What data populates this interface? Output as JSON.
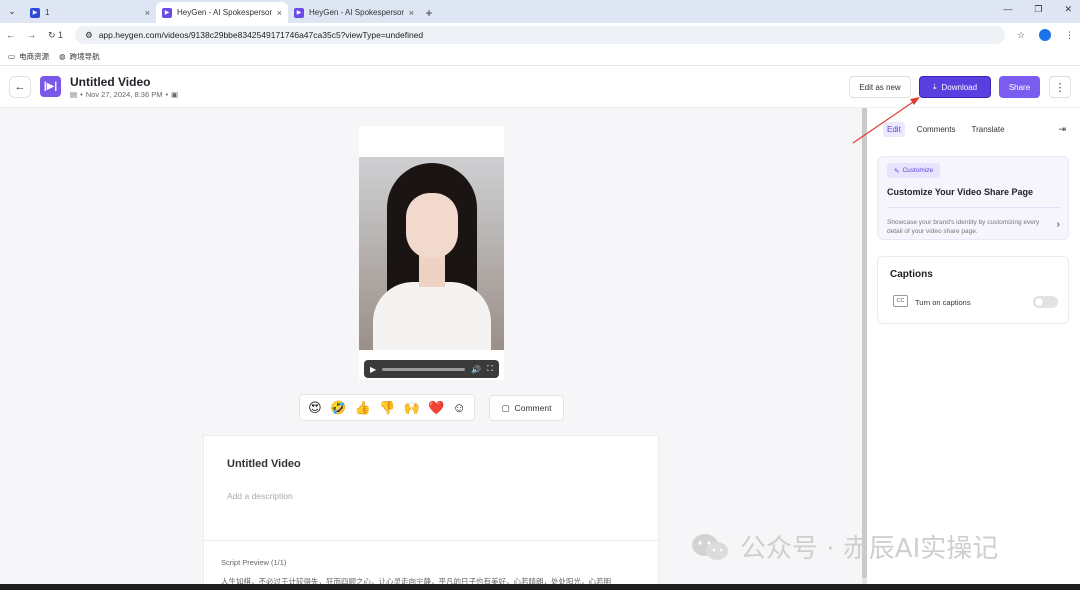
{
  "browser": {
    "tabs": [
      {
        "title": "1",
        "active": false
      },
      {
        "title": "HeyGen - AI Spokesperson V",
        "active": true
      },
      {
        "title": "HeyGen - AI Spokesperson V",
        "active": false
      }
    ],
    "tab_close_glyph": "×",
    "new_tab_glyph": "+",
    "url": "app.heygen.com/videos/9138c29bbe8342549171746a47ca35c5?viewType=undefined",
    "reload_badge": "1",
    "bookmarks": [
      "电商资源",
      "跨境导航"
    ]
  },
  "header": {
    "video_title": "Untitled Video",
    "meta_date": "Nov 27, 2024, 8:36 PM",
    "edit_as_new": "Edit as new",
    "download": "Download",
    "share": "Share"
  },
  "player": {
    "reactions": [
      "😍",
      "🤣",
      "👍",
      "👎",
      "🙌",
      "❤️",
      "☺"
    ],
    "comment_label": "Comment"
  },
  "details": {
    "title": "Untitled Video",
    "description_placeholder": "Add a description",
    "script_label": "Script Preview (1/1)",
    "script_text": "人生如棋，不必过于计较得失，狂而四顾之心，让心灵走向宁静，平凡的日子也有美好，心若晴朗，处处阳光，心若明"
  },
  "panel": {
    "tabs": [
      "Edit",
      "Comments",
      "Translate"
    ],
    "customize_chip": "Customize",
    "customize_title": "Customize Your Video Share Page",
    "customize_desc": "Showcase your brand's identity by customizing every detail of your video share page.",
    "captions_title": "Captions",
    "captions_toggle_label": "Turn on captions",
    "cc_label": "CC"
  },
  "watermark": {
    "text": "公众号 · 赤辰AI实操记"
  },
  "colors": {
    "brand": "#5b3ee0",
    "share": "#7b5cf0",
    "annotation": "#e03c2e"
  }
}
